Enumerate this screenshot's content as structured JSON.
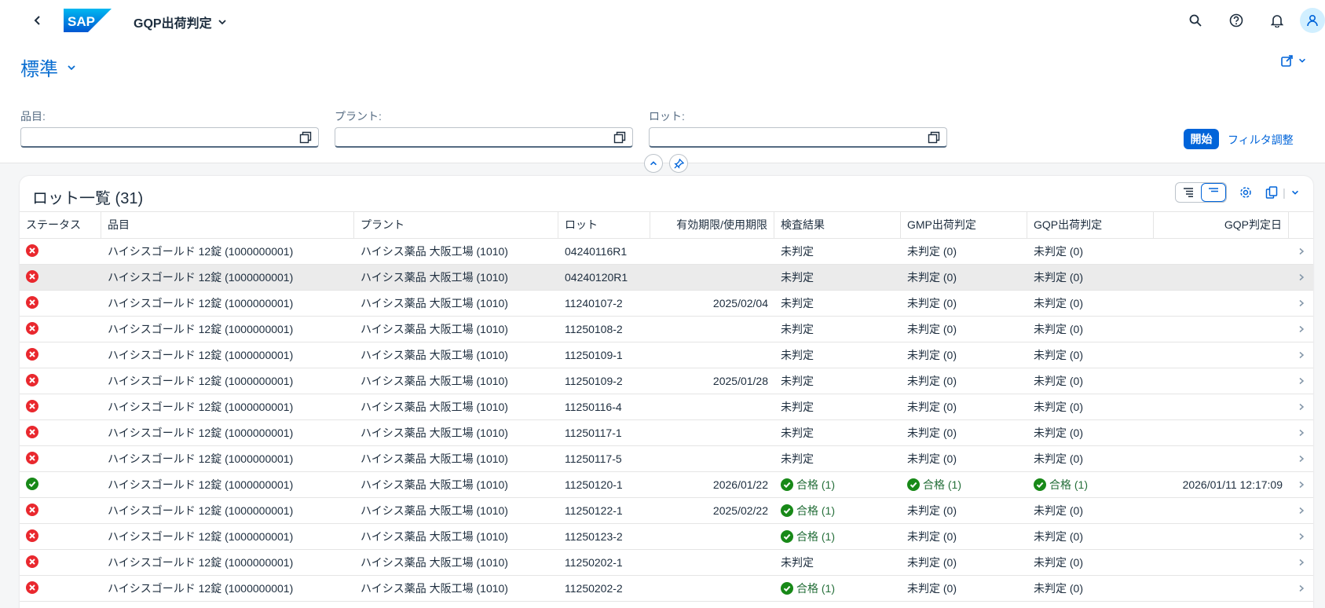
{
  "shell": {
    "app_title": "GQP出荷判定",
    "logo_text": "SAP"
  },
  "header": {
    "variant": "標準",
    "filters": [
      {
        "label": "品目:",
        "value": ""
      },
      {
        "label": "プラント:",
        "value": ""
      },
      {
        "label": "ロット:",
        "value": ""
      }
    ],
    "go_label": "開始",
    "adapt_label": "フィルタ調整"
  },
  "table": {
    "title": "ロット一覧 (31)",
    "columns": [
      "ステータス",
      "品目",
      "プラント",
      "ロット",
      "有効期限/使用期限",
      "検査結果",
      "GMP出荷判定",
      "GQP出荷判定",
      "GQP判定日"
    ],
    "rows": [
      {
        "status": "error",
        "material": "ハイシスゴールド 12錠 (1000000001)",
        "plant": "ハイシス薬品 大阪工場 (1010)",
        "lot": "04240116R1",
        "expiry": "",
        "inspection": "未判定",
        "inspection_ok": false,
        "gmp": "未判定 (0)",
        "gmp_ok": false,
        "gqp": "未判定 (0)",
        "gqp_ok": false,
        "gqp_date": ""
      },
      {
        "status": "error",
        "material": "ハイシスゴールド 12錠 (1000000001)",
        "plant": "ハイシス薬品 大阪工場 (1010)",
        "lot": "04240120R1",
        "expiry": "",
        "inspection": "未判定",
        "inspection_ok": false,
        "gmp": "未判定 (0)",
        "gmp_ok": false,
        "gqp": "未判定 (0)",
        "gqp_ok": false,
        "gqp_date": ""
      },
      {
        "status": "error",
        "material": "ハイシスゴールド 12錠 (1000000001)",
        "plant": "ハイシス薬品 大阪工場 (1010)",
        "lot": "11240107-2",
        "expiry": "2025/02/04",
        "inspection": "未判定",
        "inspection_ok": false,
        "gmp": "未判定 (0)",
        "gmp_ok": false,
        "gqp": "未判定 (0)",
        "gqp_ok": false,
        "gqp_date": ""
      },
      {
        "status": "error",
        "material": "ハイシスゴールド 12錠 (1000000001)",
        "plant": "ハイシス薬品 大阪工場 (1010)",
        "lot": "11250108-2",
        "expiry": "",
        "inspection": "未判定",
        "inspection_ok": false,
        "gmp": "未判定 (0)",
        "gmp_ok": false,
        "gqp": "未判定 (0)",
        "gqp_ok": false,
        "gqp_date": ""
      },
      {
        "status": "error",
        "material": "ハイシスゴールド 12錠 (1000000001)",
        "plant": "ハイシス薬品 大阪工場 (1010)",
        "lot": "11250109-1",
        "expiry": "",
        "inspection": "未判定",
        "inspection_ok": false,
        "gmp": "未判定 (0)",
        "gmp_ok": false,
        "gqp": "未判定 (0)",
        "gqp_ok": false,
        "gqp_date": ""
      },
      {
        "status": "error",
        "material": "ハイシスゴールド 12錠 (1000000001)",
        "plant": "ハイシス薬品 大阪工場 (1010)",
        "lot": "11250109-2",
        "expiry": "2025/01/28",
        "inspection": "未判定",
        "inspection_ok": false,
        "gmp": "未判定 (0)",
        "gmp_ok": false,
        "gqp": "未判定 (0)",
        "gqp_ok": false,
        "gqp_date": ""
      },
      {
        "status": "error",
        "material": "ハイシスゴールド 12錠 (1000000001)",
        "plant": "ハイシス薬品 大阪工場 (1010)",
        "lot": "11250116-4",
        "expiry": "",
        "inspection": "未判定",
        "inspection_ok": false,
        "gmp": "未判定 (0)",
        "gmp_ok": false,
        "gqp": "未判定 (0)",
        "gqp_ok": false,
        "gqp_date": ""
      },
      {
        "status": "error",
        "material": "ハイシスゴールド 12錠 (1000000001)",
        "plant": "ハイシス薬品 大阪工場 (1010)",
        "lot": "11250117-1",
        "expiry": "",
        "inspection": "未判定",
        "inspection_ok": false,
        "gmp": "未判定 (0)",
        "gmp_ok": false,
        "gqp": "未判定 (0)",
        "gqp_ok": false,
        "gqp_date": ""
      },
      {
        "status": "error",
        "material": "ハイシスゴールド 12錠 (1000000001)",
        "plant": "ハイシス薬品 大阪工場 (1010)",
        "lot": "11250117-5",
        "expiry": "",
        "inspection": "未判定",
        "inspection_ok": false,
        "gmp": "未判定 (0)",
        "gmp_ok": false,
        "gqp": "未判定 (0)",
        "gqp_ok": false,
        "gqp_date": ""
      },
      {
        "status": "success",
        "material": "ハイシスゴールド 12錠 (1000000001)",
        "plant": "ハイシス薬品 大阪工場 (1010)",
        "lot": "11250120-1",
        "expiry": "2026/01/22",
        "inspection": "合格 (1)",
        "inspection_ok": true,
        "gmp": "合格 (1)",
        "gmp_ok": true,
        "gqp": "合格 (1)",
        "gqp_ok": true,
        "gqp_date": "2026/01/11 12:17:09"
      },
      {
        "status": "error",
        "material": "ハイシスゴールド 12錠 (1000000001)",
        "plant": "ハイシス薬品 大阪工場 (1010)",
        "lot": "11250122-1",
        "expiry": "2025/02/22",
        "inspection": "合格 (1)",
        "inspection_ok": true,
        "gmp": "未判定 (0)",
        "gmp_ok": false,
        "gqp": "未判定 (0)",
        "gqp_ok": false,
        "gqp_date": ""
      },
      {
        "status": "error",
        "material": "ハイシスゴールド 12錠 (1000000001)",
        "plant": "ハイシス薬品 大阪工場 (1010)",
        "lot": "11250123-2",
        "expiry": "",
        "inspection": "合格 (1)",
        "inspection_ok": true,
        "gmp": "未判定 (0)",
        "gmp_ok": false,
        "gqp": "未判定 (0)",
        "gqp_ok": false,
        "gqp_date": ""
      },
      {
        "status": "error",
        "material": "ハイシスゴールド 12錠 (1000000001)",
        "plant": "ハイシス薬品 大阪工場 (1010)",
        "lot": "11250202-1",
        "expiry": "",
        "inspection": "未判定",
        "inspection_ok": false,
        "gmp": "未判定 (0)",
        "gmp_ok": false,
        "gqp": "未判定 (0)",
        "gqp_ok": false,
        "gqp_date": ""
      },
      {
        "status": "error",
        "material": "ハイシスゴールド 12錠 (1000000001)",
        "plant": "ハイシス薬品 大阪工場 (1010)",
        "lot": "11250202-2",
        "expiry": "",
        "inspection": "合格 (1)",
        "inspection_ok": true,
        "gmp": "未判定 (0)",
        "gmp_ok": false,
        "gqp": "未判定 (0)",
        "gqp_ok": false,
        "gqp_date": ""
      }
    ]
  },
  "colors": {
    "accent": "#0064d9",
    "error": "#e9282e",
    "success": "#188918",
    "success_text": "#256f3a"
  }
}
